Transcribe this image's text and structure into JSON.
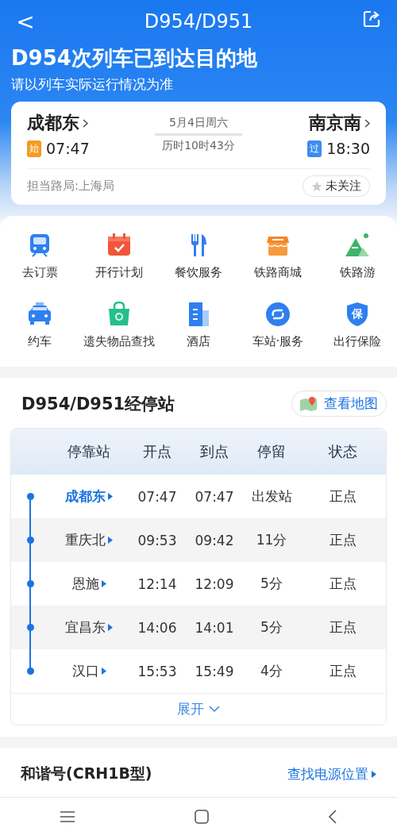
{
  "nav": {
    "back": "<",
    "title": "D954/D951"
  },
  "status": {
    "headline": "D954次列车已到达目的地",
    "note": "请以列车实际运行情况为准"
  },
  "trip": {
    "from": {
      "station": "成都东",
      "badge": "始",
      "time": "07:47"
    },
    "date": "5月4日周六",
    "duration": "历时10时43分",
    "to": {
      "station": "南京南",
      "badge": "过",
      "time": "18:30"
    },
    "bureau": "担当路局:上海局",
    "follow": {
      "label": "未关注",
      "followed": false
    }
  },
  "services": [
    {
      "kind": "train",
      "label": "去订票"
    },
    {
      "kind": "calendar",
      "label": "开行计划"
    },
    {
      "kind": "dining",
      "label": "餐饮服务"
    },
    {
      "kind": "shop",
      "label": "铁路商城"
    },
    {
      "kind": "mountain",
      "label": "铁路游"
    },
    {
      "kind": "car",
      "label": "约车"
    },
    {
      "kind": "bag",
      "label": "遗失物品查找"
    },
    {
      "kind": "building",
      "label": "酒店"
    },
    {
      "kind": "swap",
      "label": "车站·服务"
    },
    {
      "kind": "shield",
      "label": "出行保险",
      "glyph": "保"
    }
  ],
  "stops": {
    "title": "D954/D951经停站",
    "map_button": "查看地图",
    "columns": [
      "停靠站",
      "开点",
      "到点",
      "停留",
      "状态"
    ],
    "rows": [
      {
        "station": "成都东",
        "departs": "07:47",
        "arrives": "07:47",
        "stay": "出发站",
        "status": "正点",
        "selected": true
      },
      {
        "station": "重庆北",
        "departs": "09:53",
        "arrives": "09:42",
        "stay": "11分",
        "status": "正点",
        "selected": false
      },
      {
        "station": "恩施",
        "departs": "12:14",
        "arrives": "12:09",
        "stay": "5分",
        "status": "正点",
        "selected": false
      },
      {
        "station": "宜昌东",
        "departs": "14:06",
        "arrives": "14:01",
        "stay": "5分",
        "status": "正点",
        "selected": false
      },
      {
        "station": "汉口",
        "departs": "15:53",
        "arrives": "15:49",
        "stay": "4分",
        "status": "正点",
        "selected": false
      }
    ],
    "expand": "展开"
  },
  "train": {
    "model": "和谐号(CRH1B型)",
    "power_link": "查找电源位置"
  }
}
